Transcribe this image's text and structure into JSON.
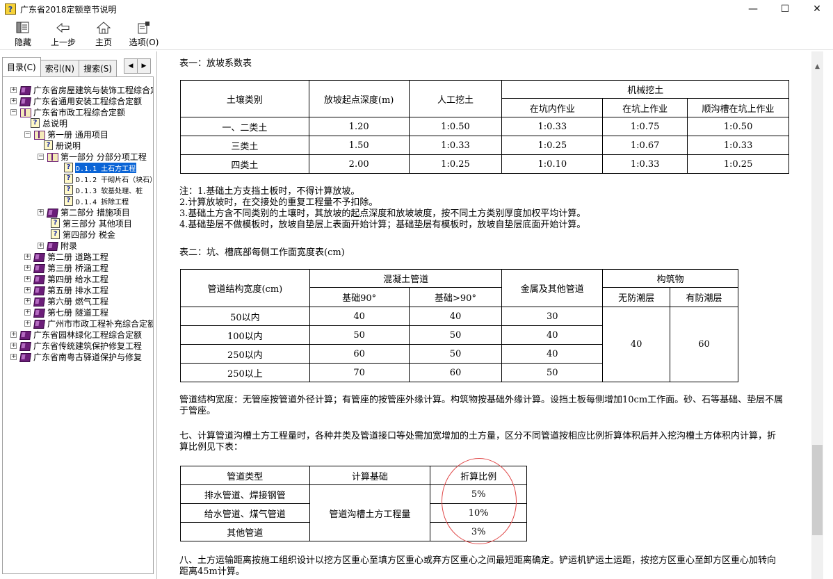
{
  "window": {
    "title": "广东省2018定额章节说明",
    "icon_glyph": "?",
    "minimize": "—",
    "maximize": "☐",
    "close": "✕"
  },
  "toolbar": {
    "hide": "隐藏",
    "back": "上一步",
    "home": "主页",
    "options": "选项(O)"
  },
  "tabs": {
    "contents": "目录(C)",
    "index": "索引(N)",
    "search": "搜索(S)",
    "prev_arrow": "◀",
    "next_arrow": "▶"
  },
  "tree": {
    "n0": "广东省房屋建筑与装饰工程综合定额",
    "n1": "广东省通用安装工程综合定额",
    "n2": "广东省市政工程综合定额",
    "n3": "总说明",
    "n4": "第一册 通用项目",
    "n5": "册说明",
    "n6": "第一部分 分部分项工程",
    "n7": "D.1.1 土石方工程",
    "n8": "D.1.2 干砌片石（块石）",
    "n9": "D.1.3 软基处理、桩",
    "n10": "D.1.4 拆除工程",
    "n11": "第二部分 措施项目",
    "n12": "第三部分 其他项目",
    "n13": "第四部分 税金",
    "n14": "附录",
    "n15": "第二册 道路工程",
    "n16": "第三册 桥涵工程",
    "n17": "第四册 给水工程",
    "n18": "第五册 排水工程",
    "n19": "第六册 燃气工程",
    "n20": "第七册 隧道工程",
    "n21": "广州市市政工程补充综合定额",
    "n22": "广东省园林绿化工程综合定额",
    "n23": "广东省传统建筑保护修复工程",
    "n24": "广东省南粤古驿道保护与修复"
  },
  "content": {
    "table1": {
      "caption": "表一：放坡系数表",
      "h_soil": "土壤类别",
      "h_depth": "放坡起点深度(m)",
      "h_manual": "人工挖土",
      "h_mech": "机械挖土",
      "h_pit_in": "在坑内作业",
      "h_pit_on": "在坑上作业",
      "h_trench": "顺沟槽在坑上作业",
      "rows": [
        [
          "一、二类土",
          "1.20",
          "1:0.50",
          "1:0.33",
          "1:0.75",
          "1:0.50"
        ],
        [
          "三类土",
          "1.50",
          "1:0.33",
          "1:0.25",
          "1:0.67",
          "1:0.33"
        ],
        [
          "四类土",
          "2.00",
          "1:0.25",
          "1:0.10",
          "1:0.33",
          "1:0.25"
        ]
      ]
    },
    "notes": [
      "注：1.基础土方支挡土板时，不得计算放坡。",
      "2.计算放坡时，在交接处的重复工程量不予扣除。",
      "3.基础土方含不同类别的土壤时，其放坡的起点深度和放坡坡度，按不同土方类别厚度加权平均计算。",
      "4.基础垫层不做模板时，放坡自垫层上表面开始计算；基础垫层有模板时，放坡自垫层底面开始计算。"
    ],
    "table2": {
      "caption": "表二：坑、槽底部每侧工作面宽度表(cm)",
      "h_width": "管道结构宽度(cm)",
      "h_concrete": "混凝土管道",
      "h_base90": "基础90°",
      "h_base_gt90": "基础>90°",
      "h_metal": "金属及其他管道",
      "h_struct": "构筑物",
      "h_no_damp": "无防潮层",
      "h_damp": "有防潮层",
      "rows": [
        [
          "50以内",
          "40",
          "40",
          "30"
        ],
        [
          "100以内",
          "50",
          "50",
          "40"
        ],
        [
          "250以内",
          "60",
          "50",
          "40"
        ],
        [
          "250以上",
          "70",
          "60",
          "50"
        ]
      ],
      "struct_no_damp": "40",
      "struct_damp": "60"
    },
    "para1": "管道结构宽度：无管座按管道外径计算；有管座的按管座外缘计算。构筑物按基础外缘计算。设挡土板每侧增加10cm工作面。砂、石等基础、垫层不属于管座。",
    "para2": "七、计算管道沟槽土方工程量时，各种井类及管道接口等处需加宽增加的土方量，区分不同管道按相应比例折算体积后并入挖沟槽土方体积内计算，折算比例见下表：",
    "table3": {
      "h_type": "管道类型",
      "h_basis": "计算基础",
      "h_ratio": "折算比例",
      "basis": "管道沟槽土方工程量",
      "rows": [
        [
          "排水管道、焊接钢管",
          "5%"
        ],
        [
          "给水管道、煤气管道",
          "10%"
        ],
        [
          "其他管道",
          "3%"
        ]
      ]
    },
    "para3": "八、土方运输距离按施工组织设计以挖方区重心至填方区重心或弃方区重心之间最短距离确定。铲运机铲运土运距，按挖方区重心至卸方区重心加转向距离45m计算。"
  }
}
